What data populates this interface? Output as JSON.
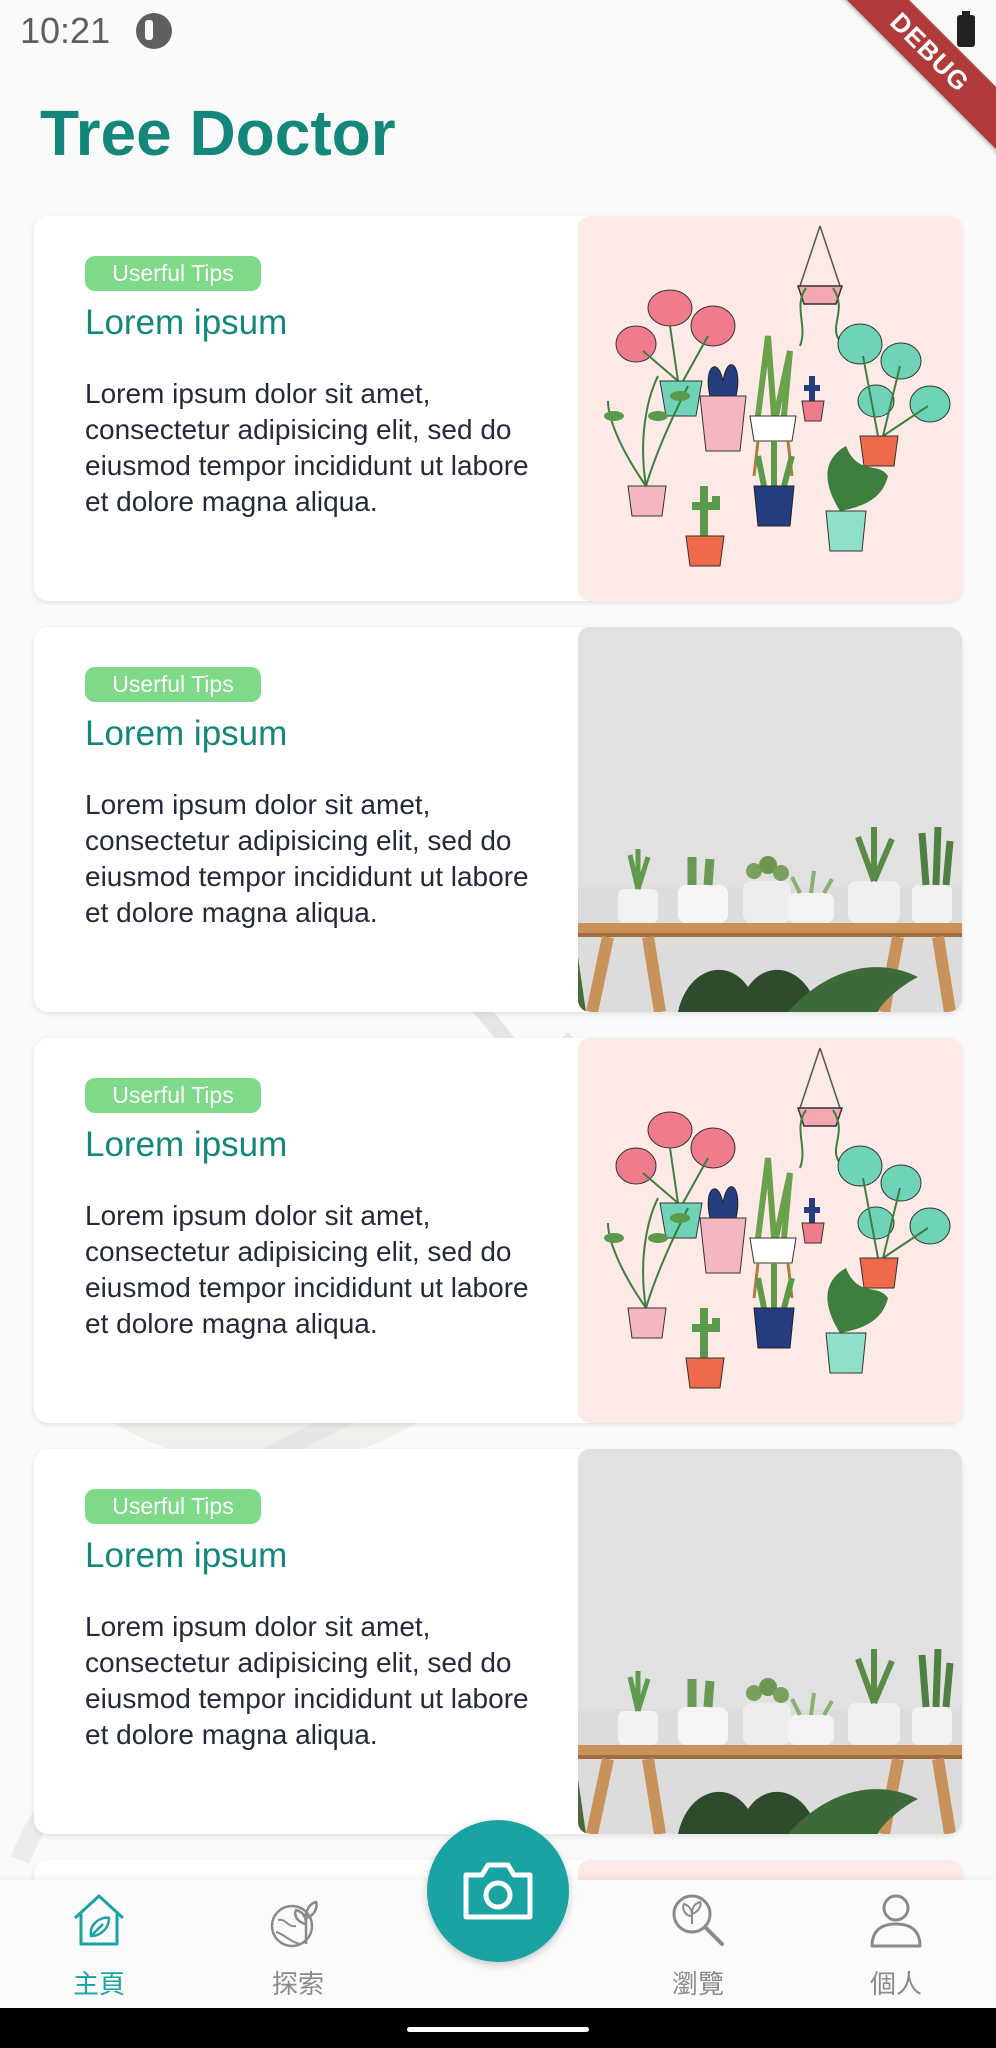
{
  "status_bar": {
    "time": "10:21"
  },
  "debug_ribbon": "DEBUG",
  "app": {
    "title": "Tree Doctor"
  },
  "cards": [
    {
      "badge": "Userful Tips",
      "title": "Lorem ipsum",
      "body": "Lorem ipsum dolor sit amet, consectetur adipisicing elit, sed do eiusmod tempor incididunt ut labore et dolore magna aliqua.",
      "image": "illustrated-plants"
    },
    {
      "badge": "Userful Tips",
      "title": "Lorem ipsum",
      "body": "Lorem ipsum dolor sit amet, consectetur adipisicing elit, sed do eiusmod tempor incididunt ut labore et dolore magna aliqua.",
      "image": "plants-on-shelf-photo"
    },
    {
      "badge": "Userful Tips",
      "title": "Lorem ipsum",
      "body": "Lorem ipsum dolor sit amet, consectetur adipisicing elit, sed do eiusmod tempor incididunt ut labore et dolore magna aliqua.",
      "image": "illustrated-plants"
    },
    {
      "badge": "Userful Tips",
      "title": "Lorem ipsum",
      "body": "Lorem ipsum dolor sit amet, consectetur adipisicing elit, sed do eiusmod tempor incididunt ut labore et dolore magna aliqua.",
      "image": "plants-on-shelf-photo"
    }
  ],
  "bottom_nav": {
    "items": [
      {
        "label": "主頁",
        "icon": "home-leaf-icon",
        "active": true
      },
      {
        "label": "探索",
        "icon": "globe-plant-icon",
        "active": false
      },
      {
        "label": "瀏覽",
        "icon": "magnifier-leaf-icon",
        "active": false
      },
      {
        "label": "個人",
        "icon": "person-icon",
        "active": false
      }
    ],
    "camera_icon": "camera-icon"
  },
  "colors": {
    "accent": "#13877a",
    "badge": "#7ed989",
    "nav_active": "#1aa3a3",
    "nav_inactive": "#8a8a8a"
  }
}
